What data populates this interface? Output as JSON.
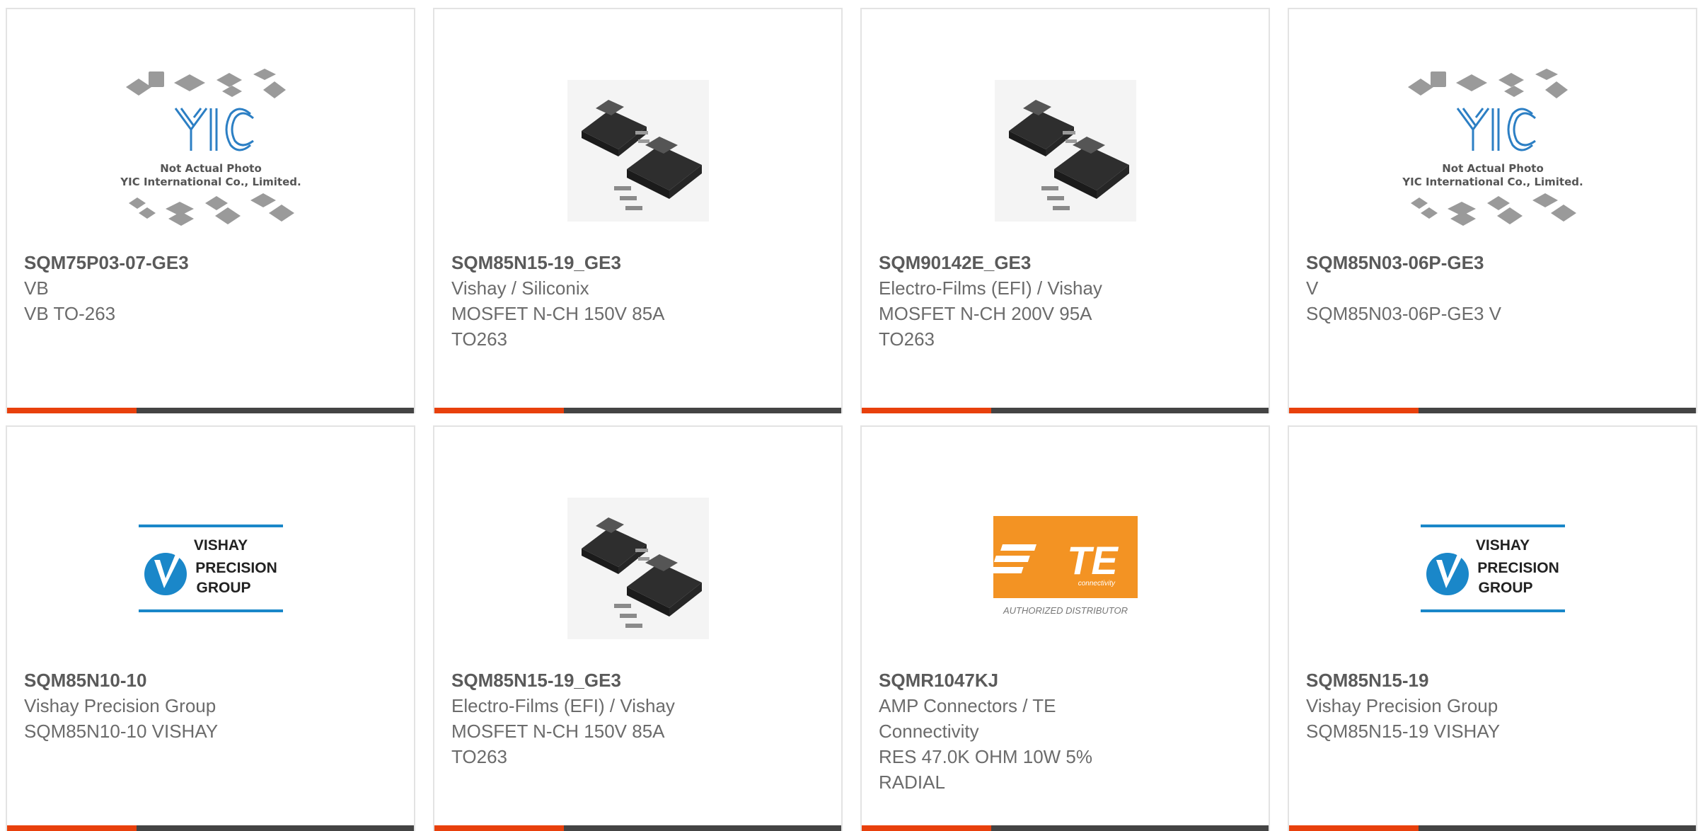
{
  "products": [
    {
      "part_number": "SQM75P03-07-GE3",
      "lines": [
        "VB",
        "VB TO-263"
      ],
      "image": "yic-placeholder",
      "placeholder_text": [
        "Not Actual Photo",
        "YIC International Co., Limited."
      ],
      "logo_text": "YIC"
    },
    {
      "part_number": "SQM85N15-19_GE3",
      "lines": [
        "Vishay / Siliconix",
        "MOSFET N-CH 150V 85A",
        "TO263"
      ],
      "image": "to263-package"
    },
    {
      "part_number": "SQM90142E_GE3",
      "lines": [
        "Electro-Films (EFI) / Vishay",
        "MOSFET N-CH 200V 95A",
        "TO263"
      ],
      "image": "to263-package"
    },
    {
      "part_number": "SQM85N03-06P-GE3",
      "lines": [
        "V",
        "SQM85N03-06P-GE3 V"
      ],
      "image": "yic-placeholder",
      "placeholder_text": [
        "Not Actual Photo",
        "YIC International Co., Limited."
      ],
      "logo_text": "YIC"
    },
    {
      "part_number": "SQM85N10-10",
      "lines": [
        "Vishay Precision Group",
        "SQM85N10-10 VISHAY"
      ],
      "image": "vishay-precision-logo",
      "logo_text": [
        "VISHAY",
        "PRECISION",
        "GROUP"
      ]
    },
    {
      "part_number": "SQM85N15-19_GE3",
      "lines": [
        "Electro-Films (EFI) / Vishay",
        "MOSFET N-CH 150V 85A",
        "TO263"
      ],
      "image": "to263-package"
    },
    {
      "part_number": "SQMR1047KJ",
      "lines": [
        "AMP Connectors / TE",
        "Connectivity",
        "RES 47.0K OHM 10W 5%",
        "RADIAL"
      ],
      "image": "te-connectivity-logo",
      "logo_text": [
        "TE",
        "connectivity",
        "AUTHORIZED DISTRIBUTOR"
      ]
    },
    {
      "part_number": "SQM85N15-19",
      "lines": [
        "Vishay Precision Group",
        "SQM85N15-19 VISHAY"
      ],
      "image": "vishay-precision-logo",
      "logo_text": [
        "VISHAY",
        "PRECISION",
        "GROUP"
      ]
    }
  ],
  "colors": {
    "accent": "#e8400c",
    "bar": "#444444",
    "card_border": "#e3e3e3",
    "title_text": "#5a5a5a",
    "body_text": "#6b6b6b",
    "yic_blue": "#2c7fc4",
    "vishay_blue": "#1a87c9",
    "te_orange": "#f39323"
  }
}
